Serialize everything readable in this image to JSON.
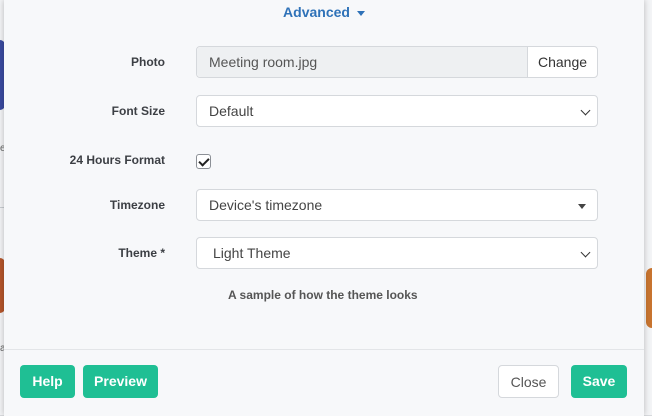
{
  "header": {
    "advanced_label": "Advanced"
  },
  "form": {
    "photo": {
      "label": "Photo",
      "value": "Meeting room.jpg",
      "change_label": "Change"
    },
    "font_size": {
      "label": "Font Size",
      "value": "Default"
    },
    "hours_format": {
      "label": "24 Hours Format",
      "checked": true
    },
    "timezone": {
      "label": "Timezone",
      "value": "Device's timezone"
    },
    "theme": {
      "label": "Theme *",
      "value": "Light Theme"
    },
    "sample_text": "A sample of how the theme looks"
  },
  "footer": {
    "help_label": "Help",
    "preview_label": "Preview",
    "close_label": "Close",
    "save_label": "Save"
  },
  "background": {
    "left_text_1": "e",
    "left_text_2": "a"
  },
  "colors": {
    "accent": "#1fbf94",
    "link": "#2f72b8"
  }
}
